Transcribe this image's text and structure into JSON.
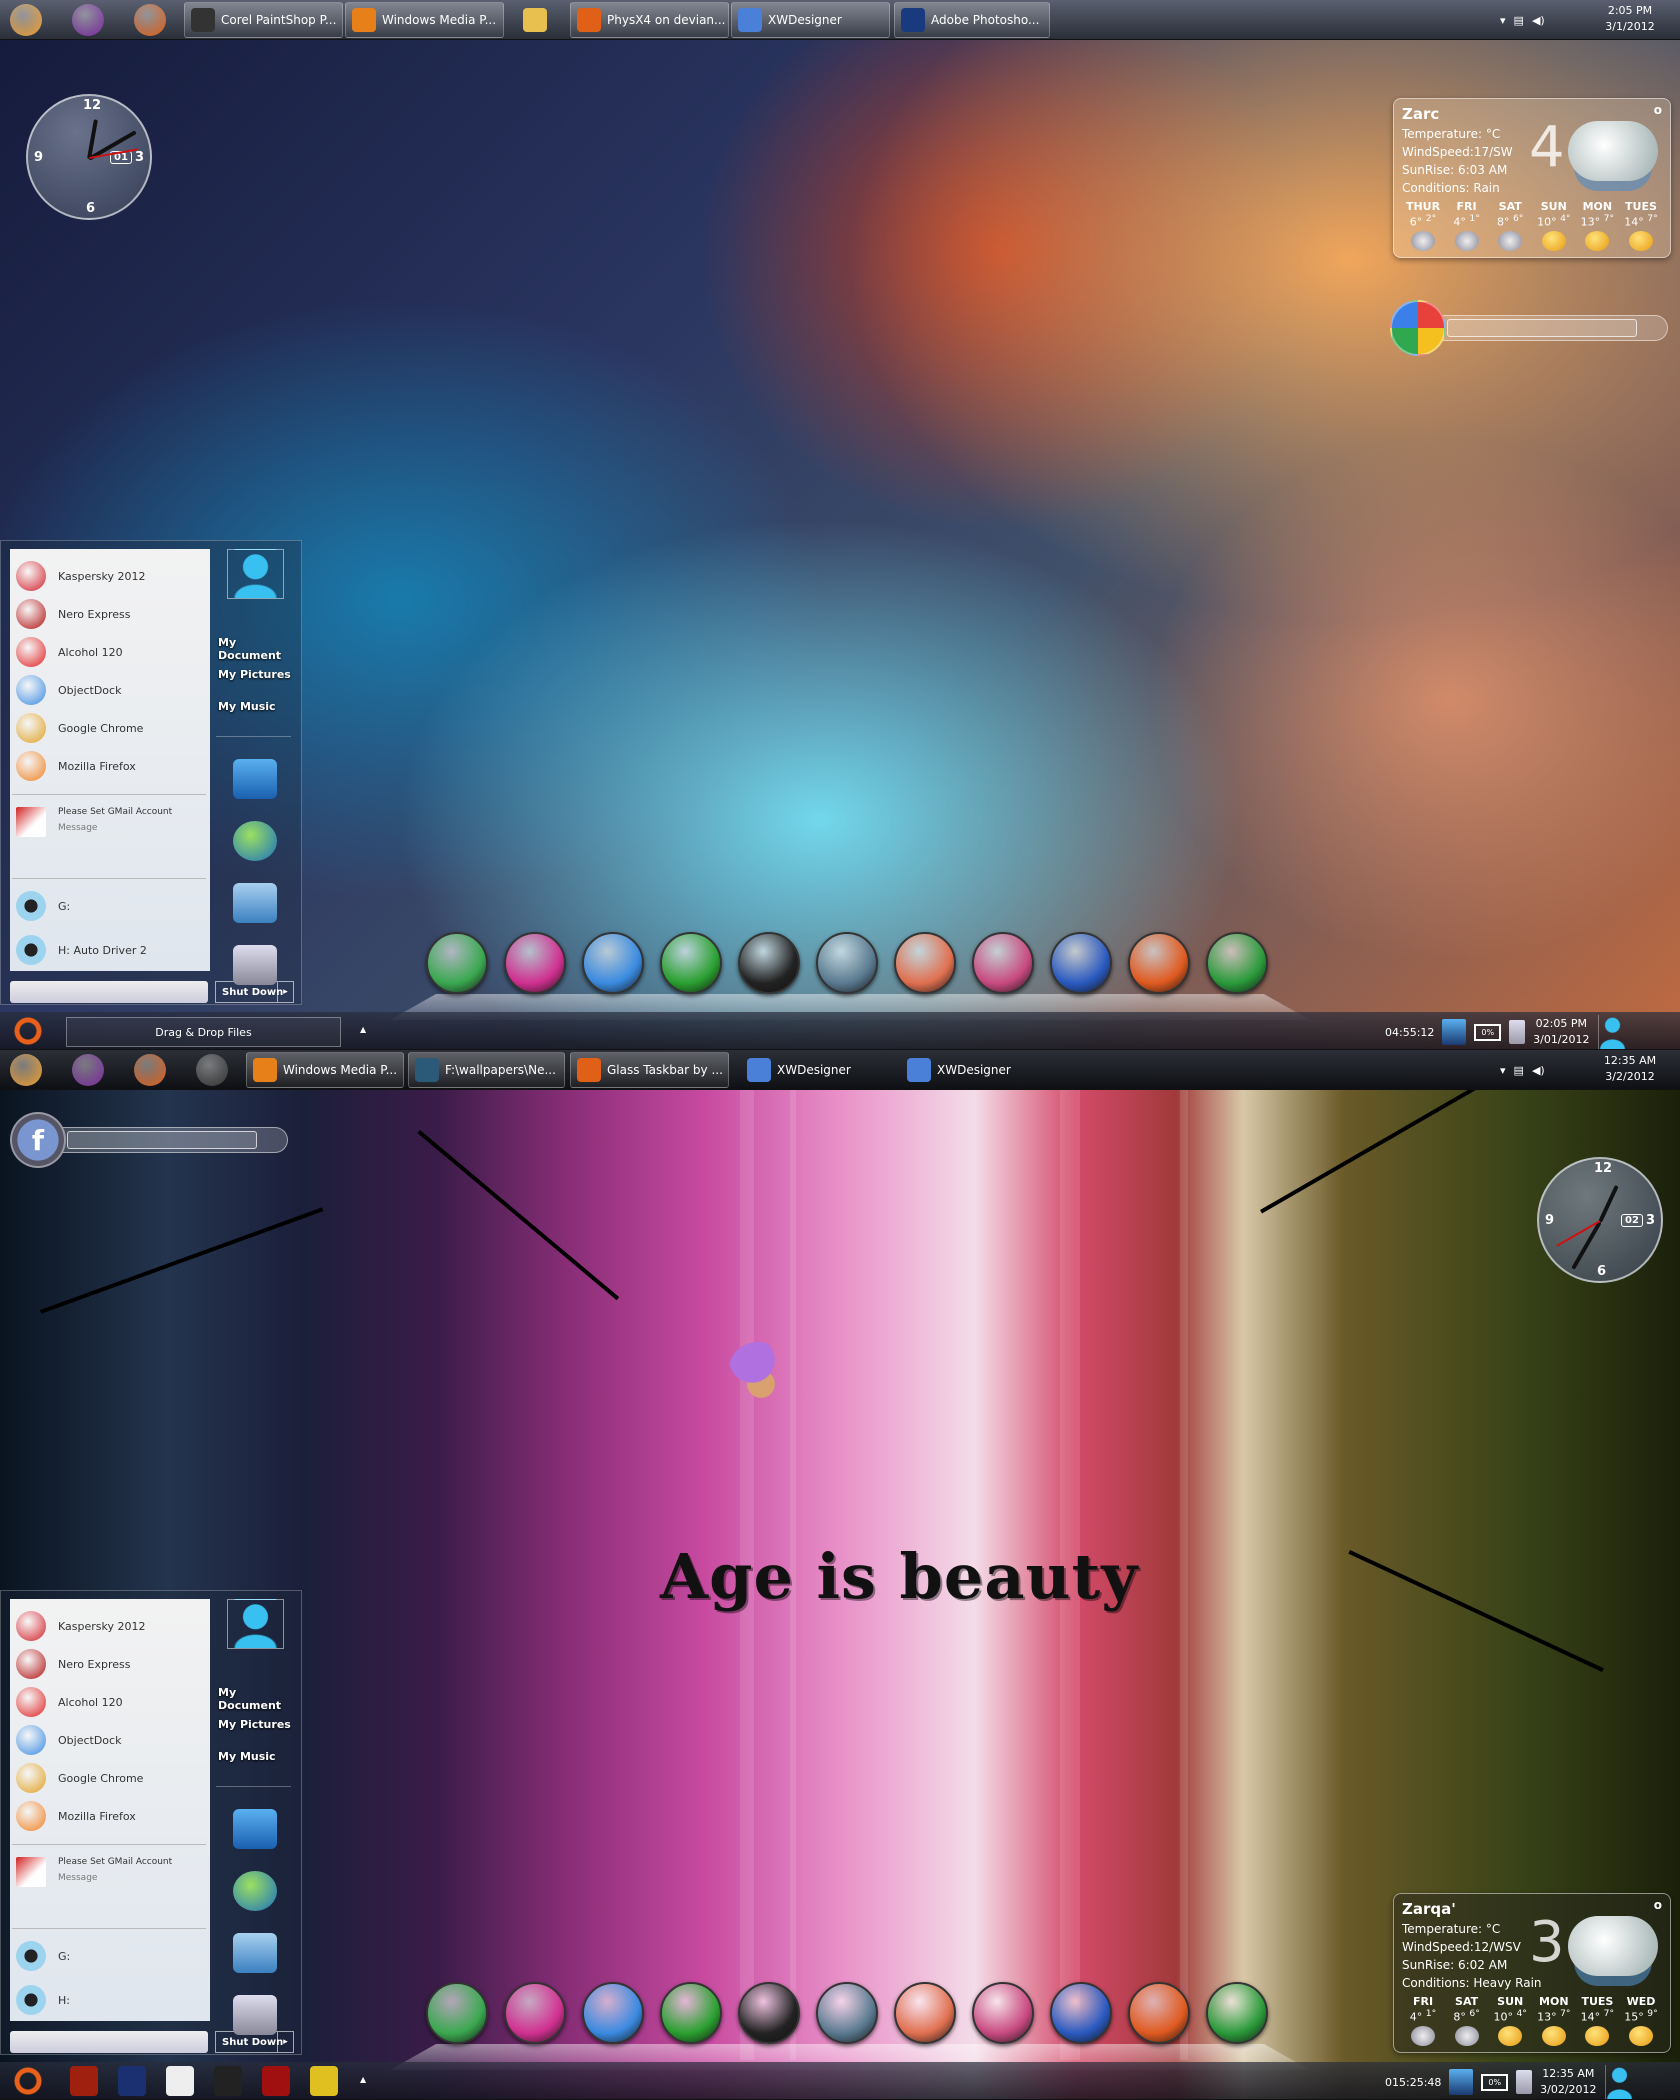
{
  "screen1": {
    "taskbar_top": {
      "quick_icons": [
        "start-orb",
        "yahoo-messenger",
        "firefox"
      ],
      "buttons": [
        {
          "label": "Corel PaintShop P...",
          "icon": "paintshop",
          "color": "#333"
        },
        {
          "label": "Windows Media P...",
          "icon": "media-player",
          "color": "#e8801a"
        },
        {
          "label": "",
          "icon": "folder",
          "color": "#e8c050"
        },
        {
          "label": "PhysX4 on devian...",
          "icon": "firefox",
          "color": "#e06018"
        },
        {
          "label": "XWDesigner",
          "icon": "xwdesigner",
          "color": "#4a80d8"
        },
        {
          "label": "Adobe Photosho...",
          "icon": "photoshop",
          "color": "#1a3a80"
        }
      ],
      "time": "2:05 PM",
      "date": "3/1/2012"
    },
    "clock": {
      "date": "01",
      "n12": "12",
      "n3": "3",
      "n6": "6",
      "n9": "9"
    },
    "weather": {
      "city": "Zarc",
      "temperature": "Temperature: °C",
      "wind": "WindSpeed:17/SW",
      "sunrise": "SunRise: 6:03 AM",
      "conditions": "Conditions: Rain",
      "current": "4",
      "option": "o",
      "forecast": [
        {
          "day": "THUR",
          "high": "6°",
          "low": "2°",
          "icon": "rain"
        },
        {
          "day": "FRI",
          "high": "4°",
          "low": "1°",
          "icon": "rain"
        },
        {
          "day": "SAT",
          "high": "8°",
          "low": "6°",
          "icon": "rain"
        },
        {
          "day": "SUN",
          "high": "10°",
          "low": "4°",
          "icon": "sun"
        },
        {
          "day": "MON",
          "high": "13°",
          "low": "7°",
          "icon": "sun"
        },
        {
          "day": "TUES",
          "high": "14°",
          "low": "7°",
          "icon": "sun"
        }
      ]
    },
    "start_menu": {
      "apps": [
        "Kaspersky 2012",
        "Nero Express",
        "Alcohol 120",
        "ObjectDock",
        "Google Chrome",
        "Mozilla Firefox"
      ],
      "gmail_title": "Please Set GMail Account",
      "gmail_sub": "Message",
      "drives": [
        "G:",
        "H: Auto Driver 2"
      ],
      "links": [
        "My Document",
        "My Pictures",
        "My Music"
      ],
      "shutdown": "Shut Down",
      "arrow": "▸"
    },
    "taskbar_bottom": {
      "dragdrop": "Drag & Drop Files",
      "arrow": "▲",
      "timer": "04:55:12",
      "battery": "0%",
      "time": "02:05 PM",
      "date": "3/01/2012"
    }
  },
  "screen2": {
    "taskbar_top": {
      "buttons": [
        {
          "label": "Windows Media P...",
          "icon": "media-player",
          "color": "#e8801a",
          "flat": false
        },
        {
          "label": "F:\\wallpapers\\Ne...",
          "icon": "folder",
          "color": "#2a5a78",
          "flat": false
        },
        {
          "label": "Glass Taskbar by ...",
          "icon": "firefox",
          "color": "#e06018",
          "flat": false
        },
        {
          "label": "XWDesigner",
          "icon": "xwdesigner",
          "color": "#4a80d8",
          "flat": true
        },
        {
          "label": "XWDesigner",
          "icon": "xwdesigner",
          "color": "#4a80d8",
          "flat": true
        }
      ],
      "time": "12:35 AM",
      "date": "3/2/2012"
    },
    "clock": {
      "date": "02",
      "n12": "12",
      "n3": "3",
      "n6": "6",
      "n9": "9"
    },
    "facebook_letter": "f",
    "wallpaper_text": "Age is beauty",
    "weather": {
      "city": "Zarqa'",
      "temperature": "Temperature: °C",
      "wind": "WindSpeed:12/WSV",
      "sunrise": "SunRise: 6:02 AM",
      "conditions": "Conditions: Heavy Rain",
      "current": "3",
      "option": "o",
      "forecast": [
        {
          "day": "FRI",
          "high": "4°",
          "low": "1°",
          "icon": "rain"
        },
        {
          "day": "SAT",
          "high": "8°",
          "low": "6°",
          "icon": "rain"
        },
        {
          "day": "SUN",
          "high": "10°",
          "low": "4°",
          "icon": "sun"
        },
        {
          "day": "MON",
          "high": "13°",
          "low": "7°",
          "icon": "sun"
        },
        {
          "day": "TUES",
          "high": "14°",
          "low": "7°",
          "icon": "sun"
        },
        {
          "day": "WED",
          "high": "15°",
          "low": "9°",
          "icon": "sun"
        }
      ]
    },
    "start_menu": {
      "apps": [
        "Kaspersky 2012",
        "Nero Express",
        "Alcohol 120",
        "ObjectDock",
        "Google Chrome",
        "Mozilla Firefox"
      ],
      "gmail_title": "Please Set GMail Account",
      "gmail_sub": "Message",
      "drives": [
        "G:",
        "H:"
      ],
      "links": [
        "My Document",
        "My Pictures",
        "My Music"
      ],
      "shutdown": "Shut Down",
      "arrow": "▸"
    },
    "taskbar_bottom": {
      "quick_icons": [
        "flash",
        "nfs",
        "bing",
        "ds",
        "app-star",
        "app-gold"
      ],
      "arrow": "▲",
      "timer": "015:25:48",
      "battery": "0%",
      "time": "12:35 AM",
      "date": "3/02/2012"
    }
  },
  "dock_icons": [
    {
      "name": "objectdock",
      "color": "#3aa850"
    },
    {
      "name": "yahoo-messenger",
      "color": "#d03090"
    },
    {
      "name": "internet-explorer",
      "color": "#3a8ae0"
    },
    {
      "name": "download-manager",
      "color": "#2aa030"
    },
    {
      "name": "media-player-classic",
      "color": "#222"
    },
    {
      "name": "app-arrows",
      "color": "#5a7a90"
    },
    {
      "name": "picasa",
      "color": "#e07050"
    },
    {
      "name": "app-pink",
      "color": "#c84a80"
    },
    {
      "name": "word",
      "color": "#2a5ac0"
    },
    {
      "name": "powerpoint",
      "color": "#e05a20"
    },
    {
      "name": "excel",
      "color": "#2a9a3a"
    }
  ],
  "app_icon_colors": [
    "#d0202a",
    "#b01010",
    "#e02020",
    "#3a8ae0",
    "#e0a020",
    "#f08020"
  ],
  "start_icon_colors": {
    "orb": "#e8601a",
    "top_orb": "#f0a030"
  }
}
